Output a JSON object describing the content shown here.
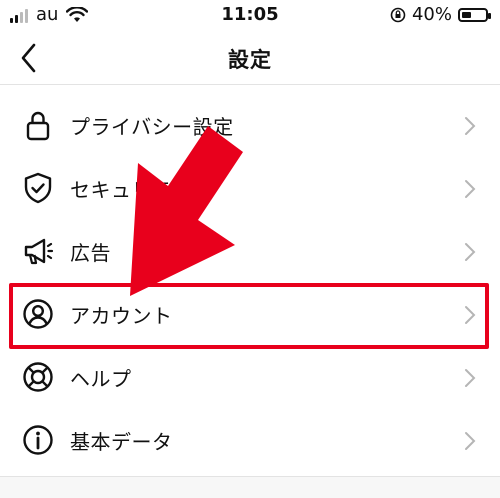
{
  "status_bar": {
    "carrier": "au",
    "time": "11:05",
    "battery_text": "40%",
    "battery_level": 0.4
  },
  "nav": {
    "title": "設定",
    "back_icon": "chevron-left-icon"
  },
  "menu": {
    "items": [
      {
        "label": "プライバシー設定",
        "icon": "lock-icon"
      },
      {
        "label": "セキュリティ",
        "icon": "shield-check-icon"
      },
      {
        "label": "広告",
        "icon": "megaphone-icon"
      },
      {
        "label": "アカウント",
        "icon": "user-circle-icon",
        "highlighted": true
      },
      {
        "label": "ヘルプ",
        "icon": "lifebuoy-icon"
      },
      {
        "label": "基本データ",
        "icon": "info-icon"
      }
    ]
  },
  "annotation": {
    "arrow_color": "#e8001c",
    "highlight_color": "#e8001c"
  }
}
